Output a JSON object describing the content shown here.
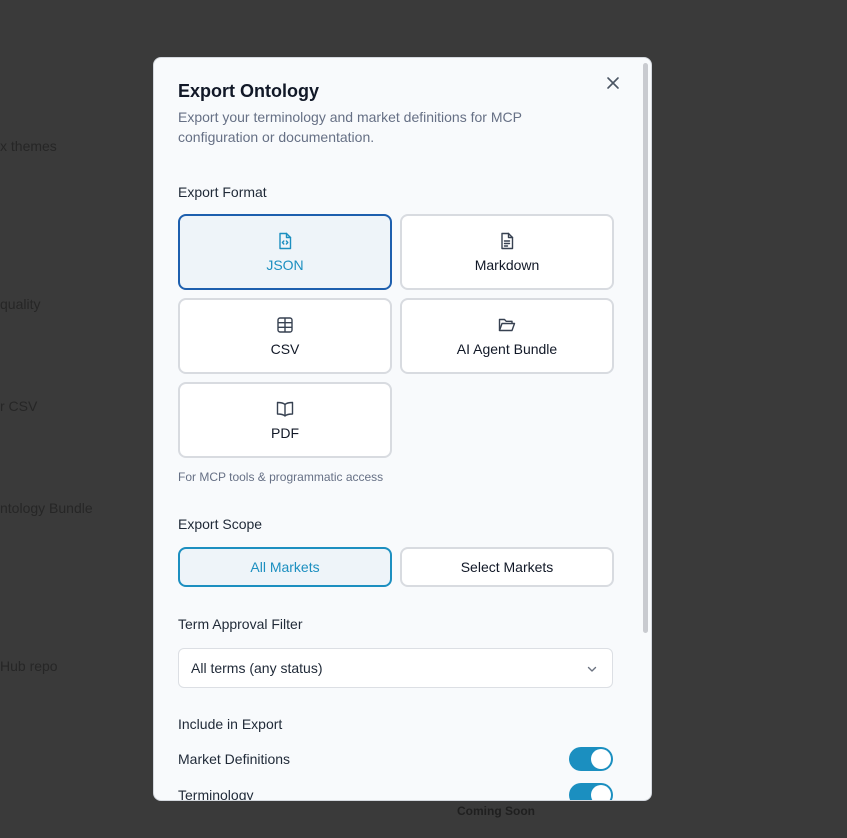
{
  "background": {
    "items": [
      {
        "label": "x themes"
      },
      {
        "label": "quality"
      },
      {
        "label": "r CSV"
      },
      {
        "label": "ntology Bundle"
      },
      {
        "label": "Hub repo"
      }
    ],
    "coming_soon": "Coming Soon"
  },
  "modal": {
    "title": "Export Ontology",
    "subtitle": "Export your terminology and market definitions for MCP configuration or documentation.",
    "close_icon": "close-icon"
  },
  "export_format": {
    "label": "Export Format",
    "options": [
      {
        "label": "JSON",
        "icon": "file-code-icon",
        "selected": true
      },
      {
        "label": "Markdown",
        "icon": "file-text-icon",
        "selected": false
      },
      {
        "label": "CSV",
        "icon": "table-icon",
        "selected": false
      },
      {
        "label": "AI Agent Bundle",
        "icon": "folder-open-icon",
        "selected": false
      },
      {
        "label": "PDF",
        "icon": "book-open-icon",
        "selected": false
      }
    ],
    "hint": "For MCP tools & programmatic access"
  },
  "export_scope": {
    "label": "Export Scope",
    "options": [
      {
        "label": "All Markets",
        "selected": true
      },
      {
        "label": "Select Markets",
        "selected": false
      }
    ]
  },
  "term_filter": {
    "label": "Term Approval Filter",
    "value": "All terms (any status)"
  },
  "include": {
    "label": "Include in Export",
    "items": [
      {
        "label": "Market Definitions",
        "enabled": true
      },
      {
        "label": "Terminology",
        "enabled": true
      }
    ]
  },
  "colors": {
    "accent": "#1c8fc0",
    "selected_border": "#1d5fae",
    "toggle_on": "#1b8fc0"
  }
}
